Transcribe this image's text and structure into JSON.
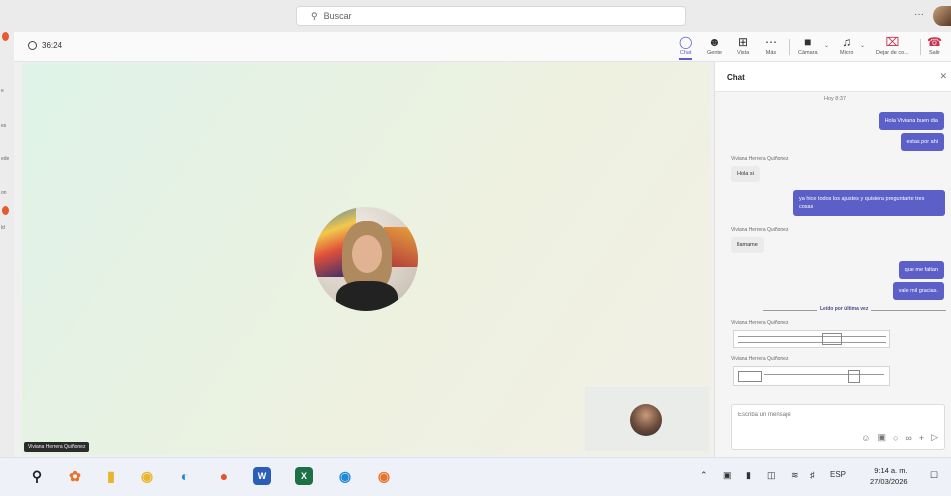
{
  "titlebar": {
    "search_placeholder": "Buscar",
    "search_icon": "search-icon",
    "more_label": "···"
  },
  "left_strip": {
    "items": [
      "e",
      "es",
      "ede",
      "on",
      "ld"
    ]
  },
  "meeting": {
    "timer": "36:24",
    "toolbar": {
      "chat": "Chat",
      "people": "Gente",
      "view": "Vista",
      "more": "Más",
      "camera": "Cámara",
      "mic": "Micro",
      "share": "Dejar de co...",
      "leave": "Salir"
    },
    "participant_name": "Viviana Herrera Quiñonez"
  },
  "chat": {
    "title": "Chat",
    "day_stamp": "Hoy 8:37",
    "messages": {
      "m1": "Hola Viviana buen dia",
      "m2": "estas por ahi",
      "s1": "Viviana Herrera Quiñonez",
      "m3": "Hola si",
      "m4": "ya hice todos los ajustes y quisiera preguntarte tres cosas",
      "s2": "Viviana Herrera Quiñonez",
      "m5": "llamame",
      "m6": "que me faltan",
      "m7": "vale mil gracias.",
      "read_label": "Leído por última vez",
      "s3": "Viviana Herrera Quiñonez",
      "s4": "Viviana Herrera Quiñonez"
    },
    "input_placeholder": "Escriba un mensaje"
  },
  "taskbar": {
    "tray": {
      "lang": "ESP"
    },
    "clock": {
      "time": "9:14 a. m.",
      "date": "27/03/2026"
    }
  },
  "colors": {
    "accent": "#5b5fc7",
    "leave": "#c4314b"
  }
}
